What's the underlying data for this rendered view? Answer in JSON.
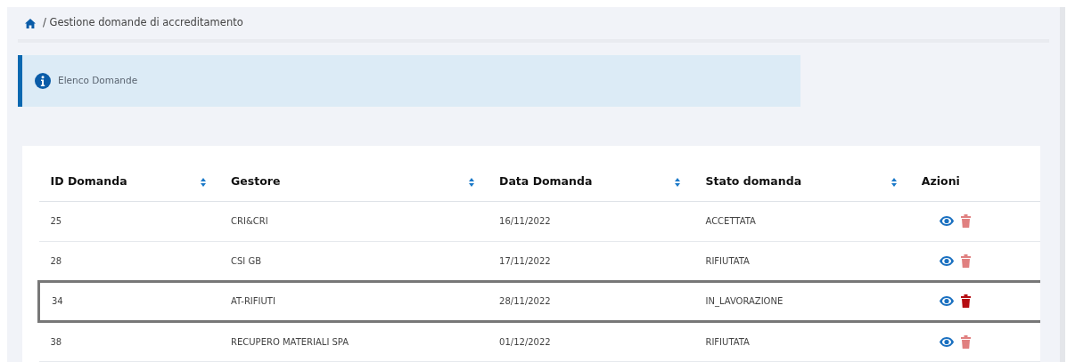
{
  "breadcrumb": {
    "current": "/ Gestione domande di accreditamento"
  },
  "alert": {
    "text": "Elenco Domande"
  },
  "table": {
    "columns": [
      {
        "label": "ID Domanda",
        "sortable": true
      },
      {
        "label": "Gestore",
        "sortable": true
      },
      {
        "label": "Data Domanda",
        "sortable": true
      },
      {
        "label": "Stato domanda",
        "sortable": true
      },
      {
        "label": "Azioni",
        "sortable": false
      }
    ],
    "rows": [
      {
        "id": "25",
        "gestore": "CRI&CRI",
        "data": "16/11/2022",
        "stato": "ACCETTATA",
        "delete_enabled": false,
        "highlighted": false
      },
      {
        "id": "28",
        "gestore": "CSI GB",
        "data": "17/11/2022",
        "stato": "RIFIUTATA",
        "delete_enabled": false,
        "highlighted": false
      },
      {
        "id": "34",
        "gestore": "AT-RIFIUTI",
        "data": "28/11/2022",
        "stato": "IN_LAVORAZIONE",
        "delete_enabled": true,
        "highlighted": true
      },
      {
        "id": "38",
        "gestore": "RECUPERO MATERIALI SPA",
        "data": "01/12/2022",
        "stato": "RIFIUTATA",
        "delete_enabled": false,
        "highlighted": false
      }
    ]
  }
}
